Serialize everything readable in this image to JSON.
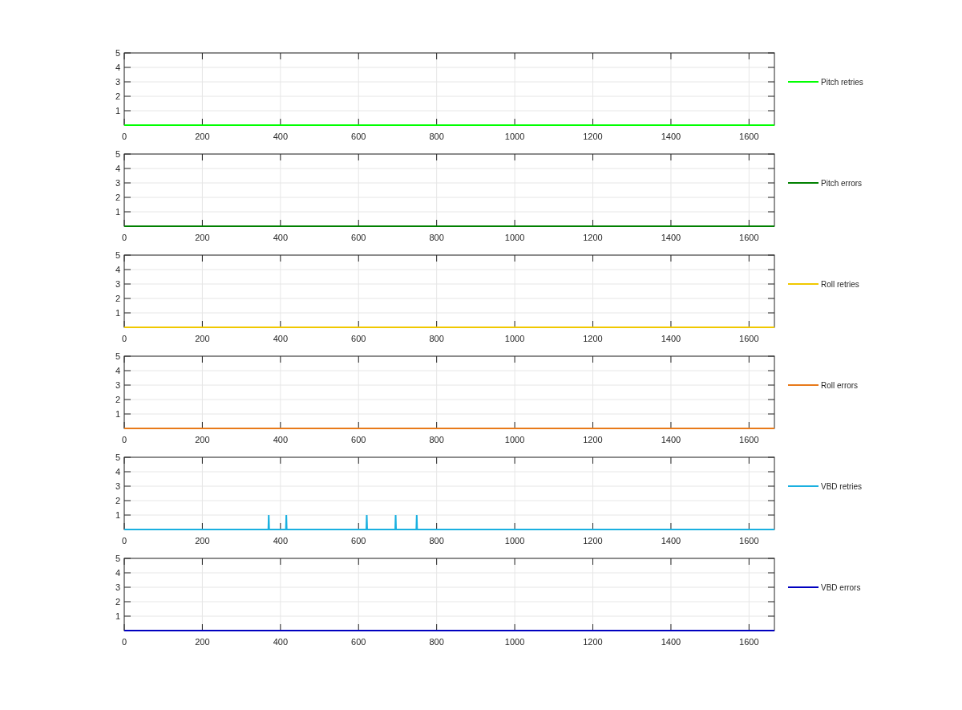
{
  "charts": [
    {
      "chart_data": {
        "type": "line",
        "x": [
          0,
          1665
        ],
        "series": [
          {
            "name": "Pitch retries",
            "color": "#00ff00",
            "values": [
              0,
              0
            ]
          }
        ],
        "grid": true,
        "xlim": [
          0,
          1665
        ],
        "ylim": [
          0,
          5
        ],
        "xticks": [
          0,
          200,
          400,
          600,
          800,
          1000,
          1200,
          1400,
          1600
        ],
        "yticks": [
          1,
          2,
          3,
          4,
          5
        ]
      }
    },
    {
      "chart_data": {
        "type": "line",
        "x": [
          0,
          1665
        ],
        "series": [
          {
            "name": "Pitch errors",
            "color": "#008000",
            "values": [
              0,
              0
            ]
          }
        ],
        "grid": true,
        "xlim": [
          0,
          1665
        ],
        "ylim": [
          0,
          5
        ],
        "xticks": [
          0,
          200,
          400,
          600,
          800,
          1000,
          1200,
          1400,
          1600
        ],
        "yticks": [
          1,
          2,
          3,
          4,
          5
        ]
      }
    },
    {
      "chart_data": {
        "type": "line",
        "x": [
          0,
          1665
        ],
        "series": [
          {
            "name": "Roll retries",
            "color": "#f0c800",
            "values": [
              0,
              0
            ]
          }
        ],
        "grid": true,
        "xlim": [
          0,
          1665
        ],
        "ylim": [
          0,
          5
        ],
        "xticks": [
          0,
          200,
          400,
          600,
          800,
          1000,
          1200,
          1400,
          1600
        ],
        "yticks": [
          1,
          2,
          3,
          4,
          5
        ]
      }
    },
    {
      "chart_data": {
        "type": "line",
        "x": [
          0,
          1665
        ],
        "series": [
          {
            "name": "Roll errors",
            "color": "#e87a1a",
            "values": [
              0,
              0
            ]
          }
        ],
        "grid": true,
        "xlim": [
          0,
          1665
        ],
        "ylim": [
          0,
          5
        ],
        "xticks": [
          0,
          200,
          400,
          600,
          800,
          1000,
          1200,
          1400,
          1600
        ],
        "yticks": [
          1,
          2,
          3,
          4,
          5
        ]
      }
    },
    {
      "chart_data": {
        "type": "line",
        "x": [
          0,
          369,
          370,
          371,
          414,
          415,
          416,
          620,
          621,
          622,
          694,
          695,
          696,
          748,
          749,
          750,
          1665
        ],
        "series": [
          {
            "name": "VBD retries",
            "color": "#1ab0e0",
            "values": [
              0,
              0,
              1,
              0,
              0,
              1,
              0,
              0,
              1,
              0,
              0,
              1,
              0,
              0,
              1,
              0,
              0
            ]
          }
        ],
        "grid": true,
        "xlim": [
          0,
          1665
        ],
        "ylim": [
          0,
          5
        ],
        "xticks": [
          0,
          200,
          400,
          600,
          800,
          1000,
          1200,
          1400,
          1600
        ],
        "yticks": [
          1,
          2,
          3,
          4,
          5
        ]
      }
    },
    {
      "chart_data": {
        "type": "line",
        "x": [
          0,
          1665
        ],
        "series": [
          {
            "name": "VBD errors",
            "color": "#0000c0",
            "values": [
              0,
              0
            ]
          }
        ],
        "grid": true,
        "xlim": [
          0,
          1665
        ],
        "ylim": [
          0,
          5
        ],
        "xticks": [
          0,
          200,
          400,
          600,
          800,
          1000,
          1200,
          1400,
          1600
        ],
        "yticks": [
          1,
          2,
          3,
          4,
          5
        ]
      }
    }
  ]
}
